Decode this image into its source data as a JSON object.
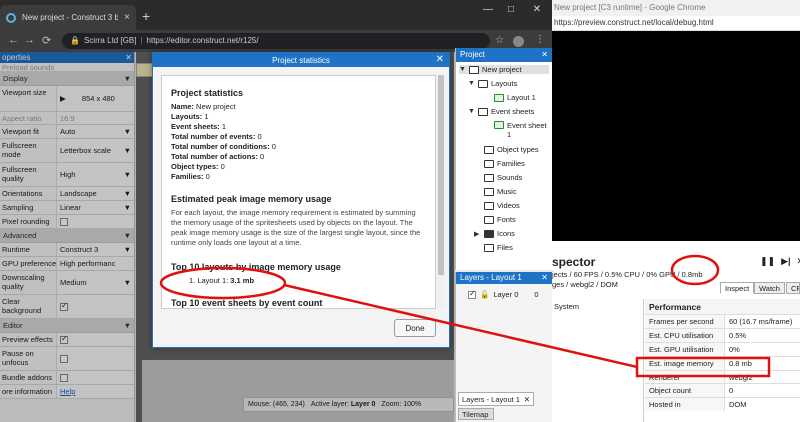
{
  "left_browser": {
    "tab_title": "New project - Construct 3 beta",
    "address_org": "Scirra Ltd [GB]",
    "address_url": "https://editor.construct.net/r125/"
  },
  "properties": {
    "header": "operties",
    "top_row": "Preload sounds",
    "sections": {
      "display": "Display",
      "advanced": "Advanced",
      "editor": "Editor"
    },
    "rows": {
      "viewport_size": {
        "name": "Viewport size",
        "value": "854 x 480"
      },
      "aspect_ratio": {
        "name": "Aspect ratio",
        "value": "16:9"
      },
      "viewport_fit": {
        "name": "Viewport fit",
        "value": "Auto"
      },
      "fullscreen_mode": {
        "name": "Fullscreen mode",
        "value": "Letterbox scale"
      },
      "fullscreen_quality": {
        "name": "Fullscreen quality",
        "value": "High"
      },
      "orientations": {
        "name": "Orientations",
        "value": "Landscape"
      },
      "sampling": {
        "name": "Sampling",
        "value": "Linear"
      },
      "pixel_rounding": {
        "name": "Pixel rounding"
      },
      "runtime": {
        "name": "Runtime",
        "value": "Construct 3"
      },
      "gpu_preference": {
        "name": "GPU preference",
        "value": "High performanc"
      },
      "downscaling_quality": {
        "name": "Downscaling quality",
        "value": "Medium"
      },
      "clear_background": {
        "name": "Clear background"
      },
      "preview_effects": {
        "name": "Preview effects"
      },
      "pause_on_unfocus": {
        "name": "Pause on unfocus"
      },
      "bundle_addons": {
        "name": "Bundle addons"
      },
      "more_information": {
        "name": "ore information",
        "value": "Help"
      }
    }
  },
  "dialog": {
    "title": "Project statistics",
    "heading": "Project statistics",
    "stats": [
      {
        "label": "Name:",
        "value": "New project"
      },
      {
        "label": "Layouts:",
        "value": "1"
      },
      {
        "label": "Event sheets:",
        "value": "1"
      },
      {
        "label": "Total number of events:",
        "value": "0"
      },
      {
        "label": "Total number of conditions:",
        "value": "0"
      },
      {
        "label": "Total number of actions:",
        "value": "0"
      },
      {
        "label": "Object types:",
        "value": "0"
      },
      {
        "label": "Families:",
        "value": "0"
      }
    ],
    "memory_heading": "Estimated peak image memory usage",
    "memory_desc": "For each layout, the image memory requirement is estimated by summing the memory usage of the spritesheets used by objects on the layout. The peak image memory usage is the size of the largest single layout, since the runtime only loads one layout at a time.",
    "top10_layouts_heading": "Top 10 layouts by image memory usage",
    "top10_item": "1. Layout 1:",
    "top10_item_value": "3.1 mb",
    "top10_events_heading": "Top 10 event sheets by event count",
    "done_label": "Done"
  },
  "project_panel": {
    "header": "Project",
    "items": {
      "root": "New project",
      "layouts": "Layouts",
      "layout1": "Layout 1",
      "event_sheets": "Event sheets",
      "event_sheet1": "Event sheet 1",
      "object_types": "Object types",
      "families": "Families",
      "sounds": "Sounds",
      "music": "Music",
      "videos": "Videos",
      "fonts": "Fonts",
      "icons": "Icons",
      "files": "Files"
    }
  },
  "layers_panel": {
    "header": "Layers - Layout 1",
    "layer_name": "Layer 0",
    "layer_value": "0",
    "bottom_tab": "Layers - Layout 1",
    "tilemap_tab": "Tilemap"
  },
  "statusbar": {
    "mouse": "Mouse: (465, 234)",
    "active_layer_label": "Active layer:",
    "active_layer_value": "Layer 0",
    "zoom": "Zoom: 100%"
  },
  "right_browser": {
    "title": "New project [C3 runtime] - Google Chrome",
    "url": "https://preview.construct.net/local/debug.html"
  },
  "inspector": {
    "title": "spector",
    "line1_prefix": "jects / 60 FPS / 0.5% CPU / 0% GPU /",
    "line1_mem": "0.8mb",
    "line2": "ges / webgl2 / DOM",
    "tabs": [
      "Inspect",
      "Watch",
      "CP"
    ],
    "system_label": "System",
    "section": "Performance",
    "rows": [
      {
        "key": "Frames per second",
        "value": "60 (16.7 ms/frame)"
      },
      {
        "key": "Est. CPU utilisation",
        "value": "0.5%"
      },
      {
        "key": "Est. GPU utilisation",
        "value": "0%"
      },
      {
        "key": "Est. image memory",
        "value": "0.8 mb"
      },
      {
        "key": "Renderer",
        "value": "webgl2"
      },
      {
        "key": "Object count",
        "value": "0"
      },
      {
        "key": "Hosted in",
        "value": "DOM"
      }
    ]
  },
  "colors": {
    "accent_blue": "#1f73c6",
    "annotation_red": "#e01010"
  }
}
